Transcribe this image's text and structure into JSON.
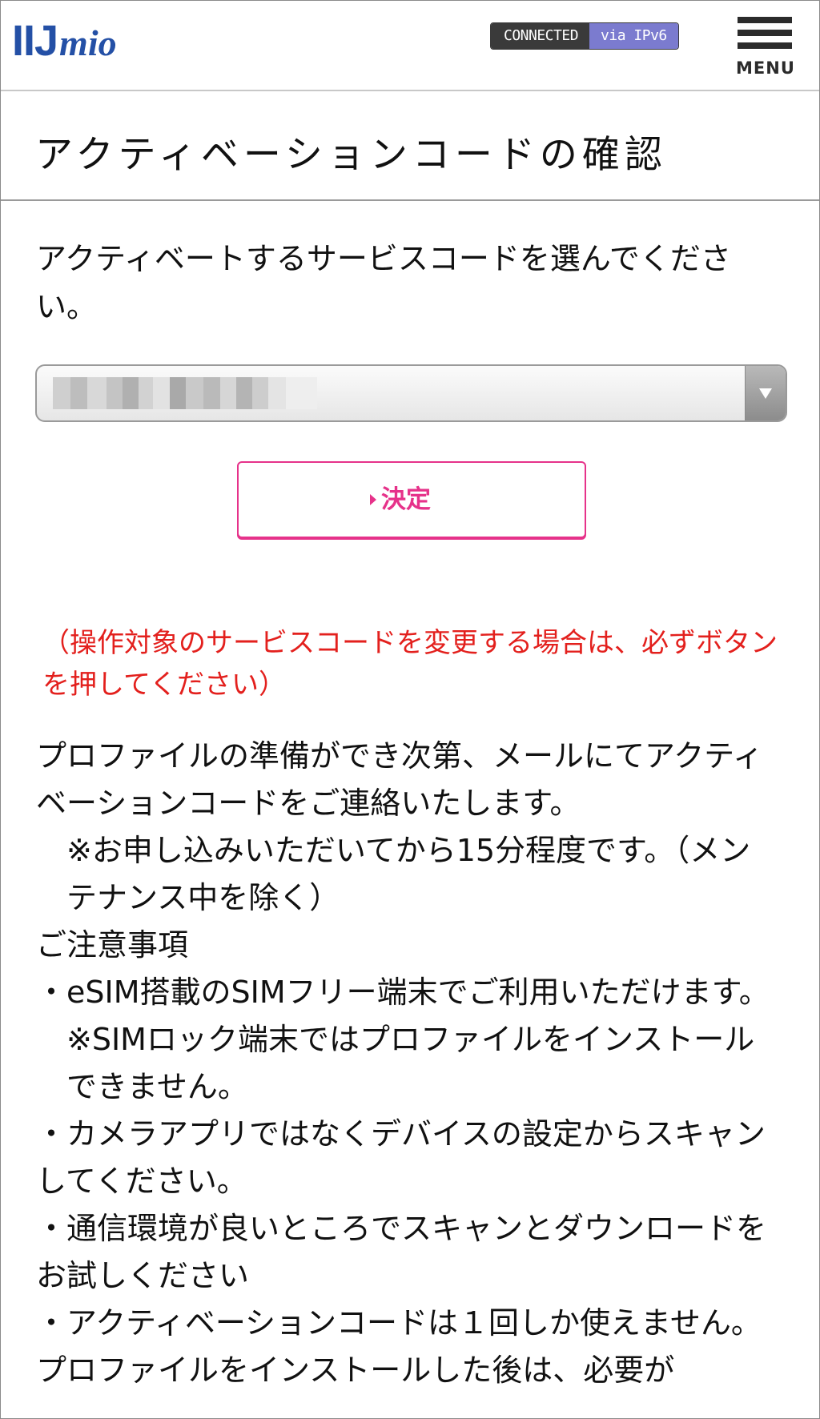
{
  "header": {
    "logo_bars": "IIJ",
    "logo_mio": "mio",
    "status_connected": "CONNECTED",
    "status_via": "via IPv6",
    "menu_label": "MENU"
  },
  "page": {
    "title": "アクティベーションコードの確認",
    "instruction": "アクティベートするサービスコードを選んでください。"
  },
  "select": {
    "value": "hdxxxxxxxxx",
    "icon": "chevron-down-icon"
  },
  "submit": {
    "label": "決定",
    "icon": "play-triangle-icon"
  },
  "notice": "（操作対象のサービスコードを変更する場合は、必ずボタンを押してください）",
  "body": [
    "プロファイルの準備ができ次第、メールにてアクティベーションコードをご連絡いたします。",
    "※お申し込みいただいてから15分程度です。（メンテナンス中を除く）",
    "ご注意事項",
    "・eSIM搭載のSIMフリー端末でご利用いただけます。",
    "※SIMロック端末ではプロファイルをインストールできません。",
    "・カメラアプリではなくデバイスの設定からスキャンしてください。",
    "・通信環境が良いところでスキャンとダウンロードをお試しください",
    "・アクティベーションコードは１回しか使えません。プロファイルをインストールした後は、必要が"
  ],
  "colors": {
    "brand_blue": "#2450a6",
    "accent_pink": "#e6328a",
    "notice_red": "#e3201d",
    "badge_dark": "#3a3a3a",
    "badge_purple": "#7b7bcf"
  }
}
